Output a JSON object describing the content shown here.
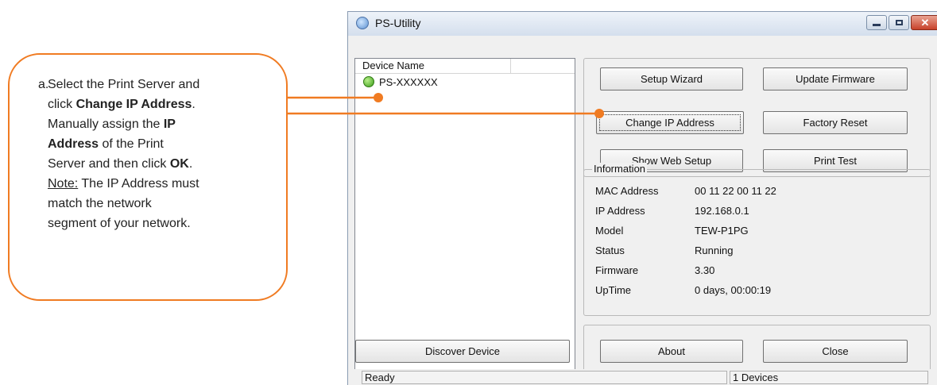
{
  "callout": {
    "number": "a.",
    "line1": "Select the Print Server and",
    "line2_prefix": "click ",
    "line2_bold": "Change IP Address",
    "line2_suffix": ".",
    "line3_prefix": "Manually assign the ",
    "line3_bold": "IP",
    "line4_bold": "Address",
    "line4_suffix": " of the Print",
    "line5_prefix": "Server and then click ",
    "line5_bold": "OK",
    "line5_suffix": ".",
    "line6_underline": "Note:",
    "line6_suffix": " The IP Address must",
    "line7": "match the network",
    "line8": "segment of your network.",
    "accent_color": "#f07b22"
  },
  "window": {
    "title": "PS-Utility",
    "title_icon": "app-globe-icon",
    "controls": {
      "minimize": "minimize-icon",
      "maximize": "maximize-icon",
      "close": "✕"
    }
  },
  "device_list": {
    "header": "Device Name",
    "items": [
      {
        "label": "PS-XXXXXX",
        "icon": "printer-status-green-icon"
      }
    ]
  },
  "buttons": {
    "setup_wizard": "Setup Wizard",
    "update_firmware": "Update Firmware",
    "change_ip": "Change IP Address",
    "factory_reset": "Factory Reset",
    "show_web_setup": "Show Web Setup",
    "print_test": "Print Test",
    "discover_device": "Discover Device",
    "about": "About",
    "close": "Close"
  },
  "information": {
    "legend": "Information",
    "rows": [
      {
        "label": "MAC Address",
        "value": "00 11 22 00 11 22"
      },
      {
        "label": "IP Address",
        "value": "192.168.0.1"
      },
      {
        "label": "Model",
        "value": "TEW-P1PG"
      },
      {
        "label": "Status",
        "value": "Running"
      },
      {
        "label": "Firmware",
        "value": "3.30"
      },
      {
        "label": "UpTime",
        "value": "0 days, 00:00:19"
      }
    ]
  },
  "statusbar": {
    "left": "Ready",
    "right": "1 Devices"
  }
}
